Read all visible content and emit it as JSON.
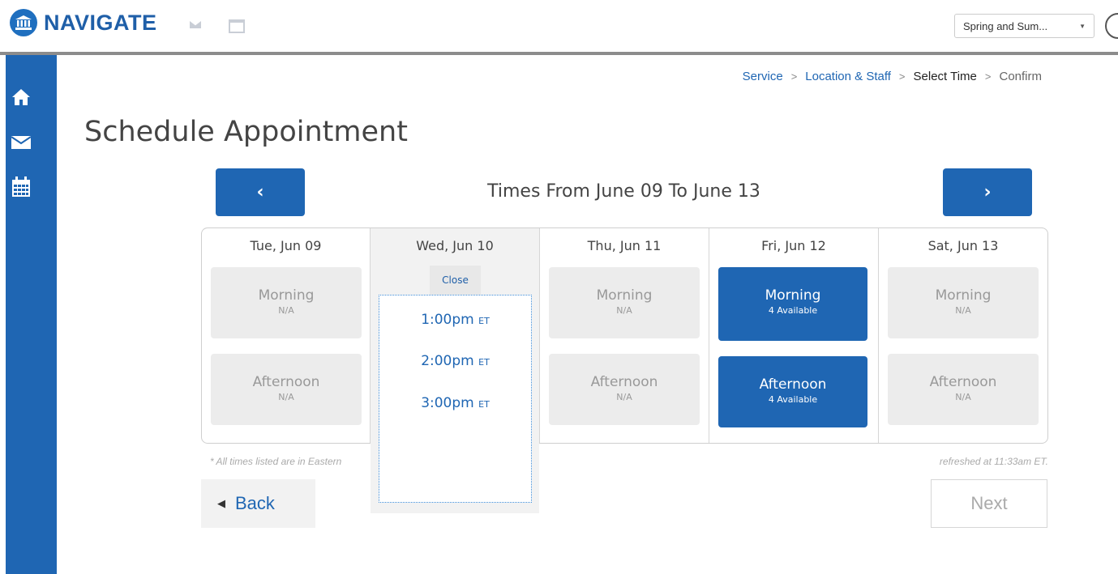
{
  "app": {
    "name": "NAVIGATE"
  },
  "header": {
    "term_select_value": "Spring and Sum..."
  },
  "icons": {
    "logo": "institution-icon",
    "mail": "mail-icon",
    "window": "window-icon",
    "home": "home-icon",
    "messages": "envelope-icon",
    "calendar": "calendar-icon"
  },
  "colors": {
    "brand": "#1f66b3",
    "slot_unavailable": "#ececec"
  },
  "breadcrumb": {
    "items": [
      {
        "label": "Service",
        "state": "link"
      },
      {
        "label": "Location & Staff",
        "state": "link"
      },
      {
        "label": "Select Time",
        "state": "active"
      },
      {
        "label": "Confirm",
        "state": "pending"
      }
    ],
    "separator": ">"
  },
  "page": {
    "title": "Schedule Appointment",
    "range_title": "Times From June 09 To June 13",
    "prev_label": "‹",
    "next_label": "›"
  },
  "days": [
    {
      "label": "Tue, Jun 09",
      "slots": [
        {
          "name": "Morning",
          "count": "N/A",
          "available": false
        },
        {
          "name": "Afternoon",
          "count": "N/A",
          "available": false
        }
      ]
    },
    {
      "label": "Wed, Jun 10",
      "slots": []
    },
    {
      "label": "Thu, Jun 11",
      "slots": [
        {
          "name": "Morning",
          "count": "N/A",
          "available": false
        },
        {
          "name": "Afternoon",
          "count": "N/A",
          "available": false
        }
      ]
    },
    {
      "label": "Fri, Jun 12",
      "slots": [
        {
          "name": "Morning",
          "count": "4 Available",
          "available": true
        },
        {
          "name": "Afternoon",
          "count": "4 Available",
          "available": true
        }
      ]
    },
    {
      "label": "Sat, Jun 13",
      "slots": [
        {
          "name": "Morning",
          "count": "N/A",
          "available": false
        },
        {
          "name": "Afternoon",
          "count": "N/A",
          "available": false
        }
      ]
    }
  ],
  "expanded": {
    "close_label": "Close",
    "times": [
      {
        "time": "1:00pm",
        "tz": "ET"
      },
      {
        "time": "2:00pm",
        "tz": "ET"
      },
      {
        "time": "3:00pm",
        "tz": "ET"
      }
    ]
  },
  "footer": {
    "note_left": "* All times listed are in Eastern",
    "note_right": "refreshed at 11:33am ET.",
    "back_label": "Back",
    "next_label": "Next"
  }
}
